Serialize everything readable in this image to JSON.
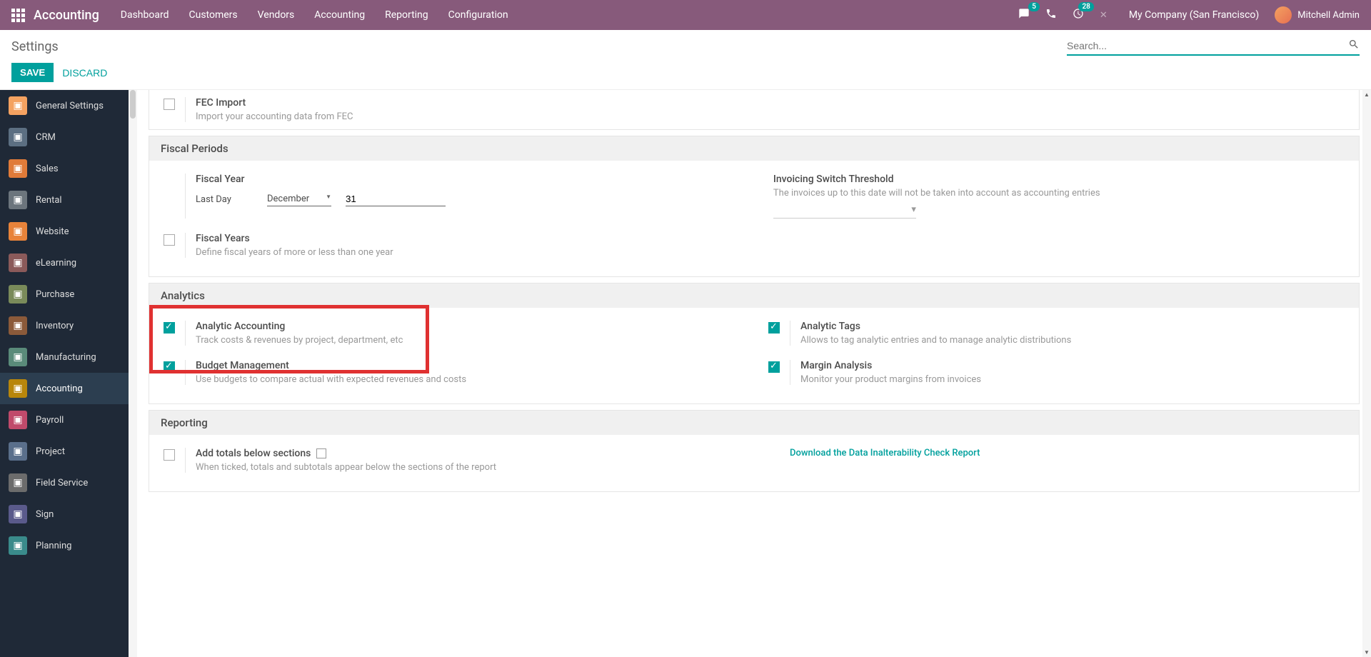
{
  "navbar": {
    "brand": "Accounting",
    "menu": [
      "Dashboard",
      "Customers",
      "Vendors",
      "Accounting",
      "Reporting",
      "Configuration"
    ],
    "chat_badge": "5",
    "clock_badge": "28",
    "company": "My Company (San Francisco)",
    "user": "Mitchell Admin"
  },
  "header": {
    "title": "Settings",
    "search_placeholder": "Search...",
    "save": "SAVE",
    "discard": "DISCARD"
  },
  "sidebar": [
    {
      "label": "General Settings",
      "color": "#f4a261"
    },
    {
      "label": "CRM",
      "color": "#5c6f82"
    },
    {
      "label": "Sales",
      "color": "#e07b39"
    },
    {
      "label": "Rental",
      "color": "#6c757d"
    },
    {
      "label": "Website",
      "color": "#e8833a"
    },
    {
      "label": "eLearning",
      "color": "#8b5a5a"
    },
    {
      "label": "Purchase",
      "color": "#7a8b5a"
    },
    {
      "label": "Inventory",
      "color": "#8b5a3a"
    },
    {
      "label": "Manufacturing",
      "color": "#5a8b7a"
    },
    {
      "label": "Accounting",
      "color": "#b8860b",
      "active": true
    },
    {
      "label": "Payroll",
      "color": "#c04a6b"
    },
    {
      "label": "Project",
      "color": "#5a6f8b"
    },
    {
      "label": "Field Service",
      "color": "#6c6c6c"
    },
    {
      "label": "Sign",
      "color": "#5a5a8b"
    },
    {
      "label": "Planning",
      "color": "#3a8b8b"
    }
  ],
  "fec": {
    "title": "FEC Import",
    "desc": "Import your accounting data from FEC"
  },
  "fiscal": {
    "header": "Fiscal Periods",
    "fy_title": "Fiscal Year",
    "last_day": "Last Day",
    "month": "December",
    "day": "31",
    "fyears_title": "Fiscal Years",
    "fyears_desc": "Define fiscal years of more or less than one year",
    "threshold_title": "Invoicing Switch Threshold",
    "threshold_desc": "The invoices up to this date will not be taken into account as accounting entries"
  },
  "analytics": {
    "header": "Analytics",
    "aa_title": "Analytic Accounting",
    "aa_desc": "Track costs & revenues by project, department, etc",
    "bm_title": "Budget Management",
    "bm_desc": "Use budgets to compare actual with expected revenues and costs",
    "at_title": "Analytic Tags",
    "at_desc": "Allows to tag analytic entries and to manage analytic distributions",
    "ma_title": "Margin Analysis",
    "ma_desc": "Monitor your product margins from invoices"
  },
  "reporting": {
    "header": "Reporting",
    "totals_title": "Add totals below sections",
    "totals_desc": "When ticked, totals and subtotals appear below the sections of the report",
    "download_link": "Download the Data Inalterability Check Report"
  }
}
